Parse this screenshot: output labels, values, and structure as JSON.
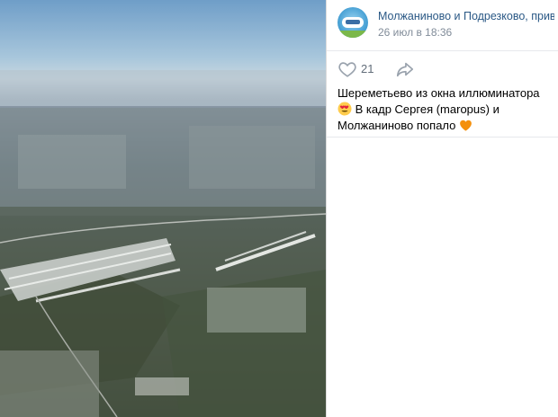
{
  "photo": {
    "alt": ""
  },
  "header": {
    "title": "Молжаниново и Подрезково, прив...",
    "date": "26 июл в 18:36"
  },
  "actions": {
    "like_count": "21",
    "like_icon": "heart-icon",
    "share_icon": "share-arrow-icon"
  },
  "post": {
    "text_part1": "Шереметьево из окна иллюминатора",
    "text_part2": " В кадр Сергея (maropus) и Молжаниново попало"
  },
  "colors": {
    "link": "#2a5885",
    "muted": "#818c99",
    "heart": "#ff6a3d"
  }
}
